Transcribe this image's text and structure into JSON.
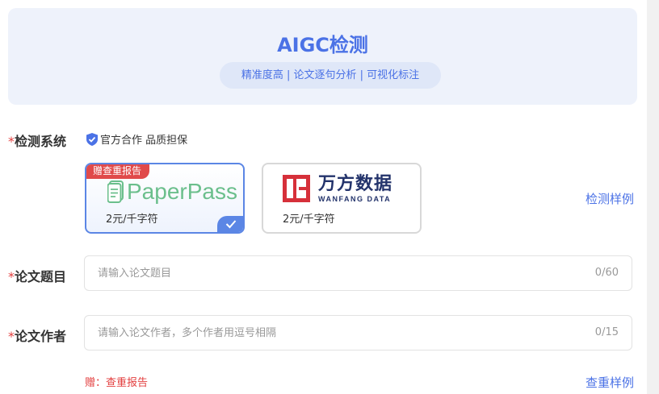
{
  "hero": {
    "title": "AIGC检测",
    "subtitle": "精准度高 | 论文逐句分析 | 可视化标注"
  },
  "system": {
    "label": "检测系统",
    "required_mark": "*",
    "assurance": "官方合作 品质担保",
    "sample_link": "检测样例",
    "options": [
      {
        "logo_text": "PaperPass",
        "tag": "赠查重报告",
        "price": "2元/千字符",
        "selected": true,
        "brand_color": "#6bbf8c"
      },
      {
        "logo_cn": "万方数据",
        "logo_en": "WANFANG DATA",
        "price": "2元/千字符",
        "selected": false,
        "brand_color": "#23336b",
        "mark_color": "#d6303a"
      }
    ]
  },
  "title_field": {
    "label": "论文题目",
    "required_mark": "*",
    "placeholder": "请输入论文题目",
    "value": "",
    "counter": "0/60"
  },
  "author_field": {
    "label": "论文作者",
    "required_mark": "*",
    "placeholder": "请输入论文作者，多个作者用逗号相隔",
    "value": "",
    "counter": "0/15"
  },
  "bottom": {
    "gift_note": "赠：查重报告",
    "sample_link": "查重样例"
  },
  "colors": {
    "accent": "#4b72e6",
    "required": "#e33f3f",
    "hero_bg": "#eef2fb"
  }
}
